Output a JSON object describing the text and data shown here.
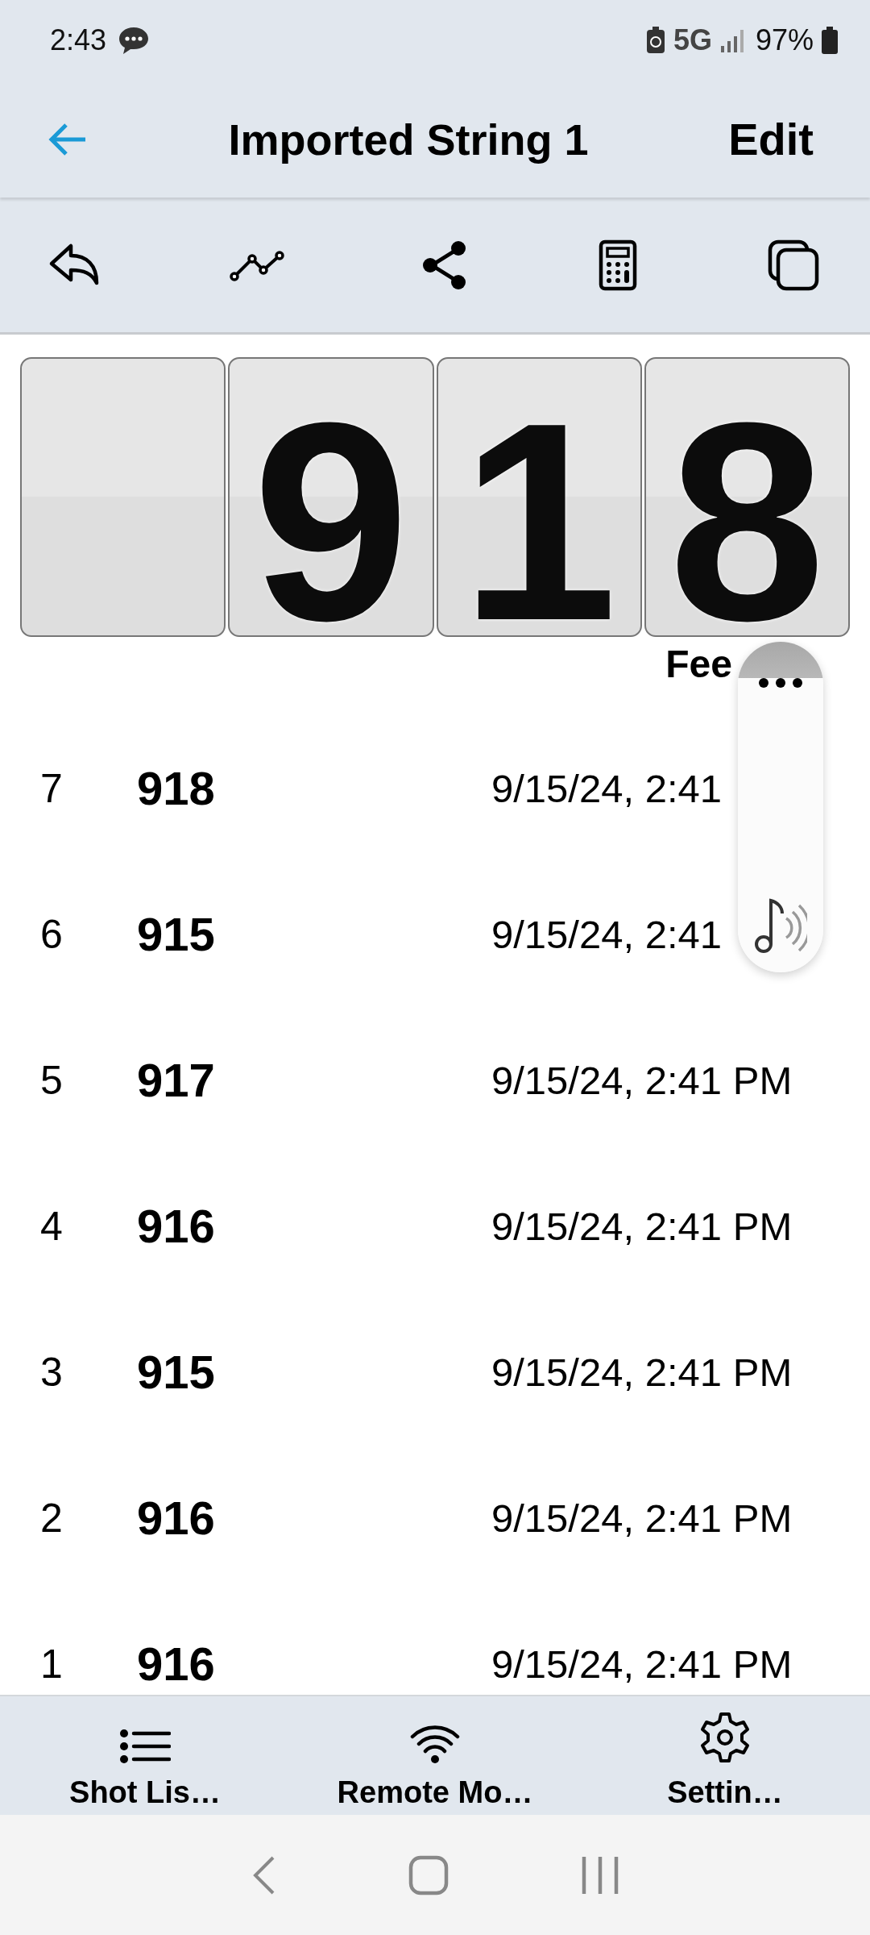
{
  "status_bar": {
    "time": "2:43",
    "network": "5G",
    "battery": "97%"
  },
  "header": {
    "title": "Imported String 1",
    "action": "Edit"
  },
  "display": {
    "digits": [
      "9",
      "1",
      "8"
    ],
    "unit": "Fee"
  },
  "shots": [
    {
      "number": "7",
      "value": "918",
      "time": "9/15/24, 2:41"
    },
    {
      "number": "6",
      "value": "915",
      "time": "9/15/24, 2:41"
    },
    {
      "number": "5",
      "value": "917",
      "time": "9/15/24, 2:41 PM"
    },
    {
      "number": "4",
      "value": "916",
      "time": "9/15/24, 2:41 PM"
    },
    {
      "number": "3",
      "value": "915",
      "time": "9/15/24, 2:41 PM"
    },
    {
      "number": "2",
      "value": "916",
      "time": "9/15/24, 2:41 PM"
    },
    {
      "number": "1",
      "value": "916",
      "time": "9/15/24, 2:41 PM"
    }
  ],
  "tabs": [
    {
      "kind": "list",
      "label": "Shot Lis…"
    },
    {
      "kind": "wifi",
      "label": "Remote Mo…"
    },
    {
      "kind": "gear",
      "label": "Settin…"
    }
  ]
}
